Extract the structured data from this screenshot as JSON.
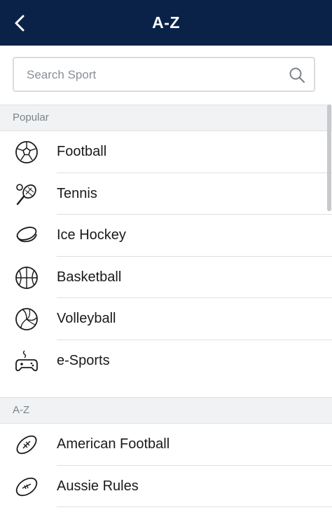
{
  "header": {
    "title": "A-Z",
    "back_icon": "chevron-left-icon"
  },
  "search": {
    "placeholder": "Search Sport",
    "value": "",
    "icon": "search-icon"
  },
  "popular": {
    "heading": "Popular",
    "items": [
      {
        "label": "Football",
        "icon": "soccer-ball-icon"
      },
      {
        "label": "Tennis",
        "icon": "tennis-racket-icon"
      },
      {
        "label": "Ice Hockey",
        "icon": "hockey-puck-icon"
      },
      {
        "label": "Basketball",
        "icon": "basketball-icon"
      },
      {
        "label": "Volleyball",
        "icon": "volleyball-icon"
      },
      {
        "label": "e-Sports",
        "icon": "gamepad-icon"
      }
    ]
  },
  "az": {
    "heading": "A-Z",
    "items": [
      {
        "label": "American Football",
        "icon": "american-football-icon"
      },
      {
        "label": "Aussie Rules",
        "icon": "aussie-rules-ball-icon"
      }
    ]
  },
  "colors": {
    "header_bg": "#0b2248",
    "section_bg": "#f0f2f4"
  }
}
